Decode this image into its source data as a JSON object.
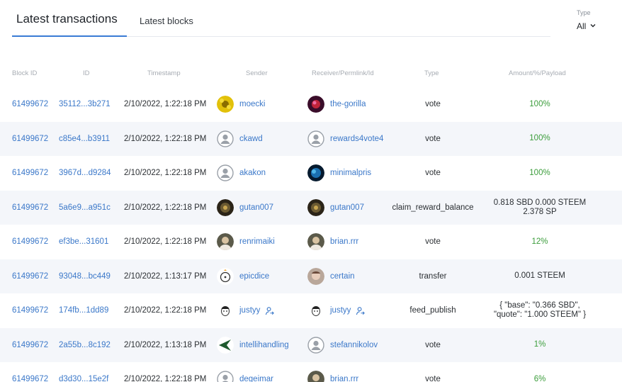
{
  "tabs": [
    {
      "label": "Latest transactions",
      "active": true
    },
    {
      "label": "Latest blocks",
      "active": false
    }
  ],
  "type_filter": {
    "label": "Type",
    "value": "All"
  },
  "columns": [
    "Block ID",
    "ID",
    "Timestamp",
    "Sender",
    "Receiver/Permlink/Id",
    "Type",
    "Amount/%/Payload"
  ],
  "colors": {
    "accent": "#3a7bd5",
    "link": "#3b78c9",
    "positive": "#3c9d3c",
    "row_alt": "#f4f6fa"
  },
  "rows": [
    {
      "block": "61499672",
      "id": "35112...3b271",
      "timestamp": "2/10/2022, 1:22:18 PM",
      "sender": "moecki",
      "receiver": "the-gorilla",
      "type": "vote",
      "amount": "100%",
      "amount2": ""
    },
    {
      "block": "61499672",
      "id": "c85e4...b3911",
      "timestamp": "2/10/2022, 1:22:18 PM",
      "sender": "ckawd",
      "receiver": "rewards4vote4",
      "type": "vote",
      "amount": "100%",
      "amount2": ""
    },
    {
      "block": "61499672",
      "id": "3967d...d9284",
      "timestamp": "2/10/2022, 1:22:18 PM",
      "sender": "akakon",
      "receiver": "minimalpris",
      "type": "vote",
      "amount": "100%",
      "amount2": ""
    },
    {
      "block": "61499672",
      "id": "5a6e9...a951c",
      "timestamp": "2/10/2022, 1:22:18 PM",
      "sender": "gutan007",
      "receiver": "gutan007",
      "type": "claim_reward_balance",
      "amount": "0.818 SBD 0.000 STEEM",
      "amount2": "2.378 SP"
    },
    {
      "block": "61499672",
      "id": "ef3be...31601",
      "timestamp": "2/10/2022, 1:22:18 PM",
      "sender": "renrimaiki",
      "receiver": "brian.rrr",
      "type": "vote",
      "amount": "12%",
      "amount2": ""
    },
    {
      "block": "61499672",
      "id": "93048...bc449",
      "timestamp": "2/10/2022, 1:13:17 PM",
      "sender": "epicdice",
      "receiver": "certain",
      "type": "transfer",
      "amount": "0.001 STEEM",
      "amount2": ""
    },
    {
      "block": "61499672",
      "id": "174fb...1dd89",
      "timestamp": "2/10/2022, 1:22:18 PM",
      "sender": "justyy",
      "receiver": "justyy",
      "type": "feed_publish",
      "amount": "{ \"base\": \"0.366 SBD\",",
      "amount2": "\"quote\": \"1.000 STEEM\" }"
    },
    {
      "block": "61499672",
      "id": "2a55b...8c192",
      "timestamp": "2/10/2022, 1:13:18 PM",
      "sender": "intellihandling",
      "receiver": "stefannikolov",
      "type": "vote",
      "amount": "1%",
      "amount2": ""
    },
    {
      "block": "61499672",
      "id": "d3d30...15e2f",
      "timestamp": "2/10/2022, 1:22:18 PM",
      "sender": "degeimar",
      "receiver": "brian.rrr",
      "type": "vote",
      "amount": "6%",
      "amount2": ""
    }
  ],
  "avatars": {
    "moecki": "flower-avatar-icon",
    "the-gorilla": "red-abstract-avatar-icon",
    "ckawd": "default-user-avatar-icon",
    "rewards4vote4": "default-user-avatar-icon",
    "akakon": "default-user-avatar-icon",
    "minimalpris": "blue-planet-avatar-icon",
    "gutan007": "dark-photo-avatar-icon",
    "renrimaiki": "portrait-photo-avatar-icon",
    "brian.rrr": "portrait-photo-avatar-icon",
    "epicdice": "dice-logo-avatar-icon",
    "certain": "face-photo-avatar-icon",
    "justyy": "cartoon-face-avatar-icon",
    "intellihandling": "green-arrow-logo-avatar-icon",
    "stefannikolov": "default-user-avatar-icon",
    "degeimar": "default-user-avatar-icon"
  }
}
